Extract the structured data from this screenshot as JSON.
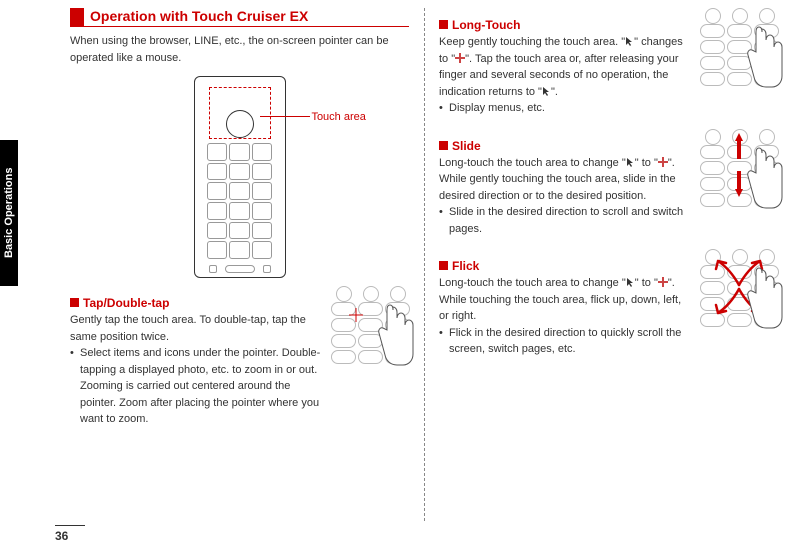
{
  "sidebar": {
    "title": "Basic Operations"
  },
  "page_number": "36",
  "main_heading": "Operation with Touch Cruiser EX",
  "intro": "When using the browser, LINE, etc., the on-screen pointer can be operated like a mouse.",
  "touch_area_label": "Touch area",
  "sections": {
    "tap": {
      "title": "Tap/Double-tap",
      "body": "Gently tap the touch area. To double-tap, tap the same position twice.",
      "bullet": "Select items and icons under the pointer. Double-tapping a displayed photo, etc. to zoom in or out. Zooming is carried out centered around the pointer. Zoom after placing the pointer where you want to zoom."
    },
    "longtouch": {
      "title": "Long-Touch",
      "body1": "Keep gently touching the touch area. \"",
      "body2": "\" changes to \"",
      "body3": "\". Tap the touch area or, after releasing your finger and several seconds of no operation, the indication returns to \"",
      "body4": "\".",
      "bullet": "Display menus, etc."
    },
    "slide": {
      "title": "Slide",
      "body1": "Long-touch the touch area to change \"",
      "body2": "\" to \"",
      "body3": "\".",
      "body4": "While gently touching the touch area, slide in the desired direction or to the desired position.",
      "bullet": "Slide in the desired direction to scroll and switch pages."
    },
    "flick": {
      "title": "Flick",
      "body1": "Long-touch the touch area to change \"",
      "body2": "\" to \"",
      "body3": "\".",
      "body4": "While touching the touch area, flick up, down, left, or right.",
      "bullet": "Flick in the desired direction to quickly scroll the screen, switch pages, etc."
    }
  }
}
